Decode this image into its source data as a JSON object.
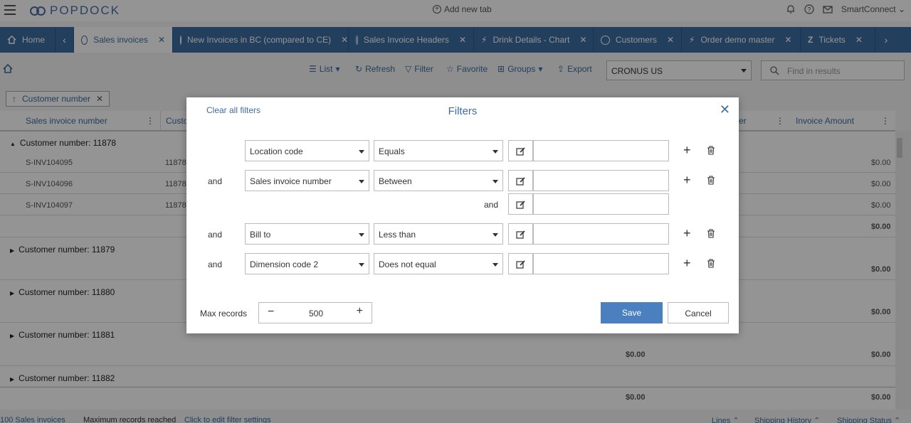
{
  "header": {
    "logo_text": "POPDOCK",
    "add_tab": "Add new tab",
    "user": "SmartConnect"
  },
  "tabs": [
    {
      "label": "Home"
    },
    {
      "label": "Sales invoices"
    },
    {
      "label": "New Invoices in BC (compared to CE)"
    },
    {
      "label": "Sales Invoice Headers"
    },
    {
      "label": "Drink Details - Chart"
    },
    {
      "label": "Customers"
    },
    {
      "label": "Order demo master"
    },
    {
      "label": "Tickets"
    }
  ],
  "toolbar": {
    "list": "List",
    "refresh": "Refresh",
    "filter": "Filter",
    "favorite": "Favorite",
    "groups": "Groups",
    "export": "Export",
    "company": "CRONUS US",
    "find_placeholder": "Find in results"
  },
  "group_chip": "Customer number",
  "grid": {
    "col_invoice": "Sales invoice number",
    "col_customer": "Custo",
    "col_partial": "er",
    "col_amount": "Invoice Amount",
    "groups": [
      {
        "label": "Customer number: 11878",
        "rows": [
          {
            "inv": "S-INV104095",
            "cust": "11878",
            "amount": "$0.00"
          },
          {
            "inv": "S-INV104096",
            "cust": "11878",
            "amount": "$0.00"
          },
          {
            "inv": "S-INV104097",
            "cust": "11878",
            "amount": "$0.00"
          }
        ],
        "subtotal": "$0.00"
      },
      {
        "label": "Customer number: 11879",
        "subtotal": "$0.00"
      },
      {
        "label": "Customer number: 11880",
        "subtotal": "$0.00"
      },
      {
        "label": "Customer number: 11881",
        "subtotal": "$0.00",
        "mid": "$0.00"
      },
      {
        "label": "Customer number: 11882"
      }
    ],
    "total_mid": "$0.00",
    "total": "$0.00"
  },
  "footer": {
    "count": "100 Sales invoices",
    "max_note": "Maximum records reached",
    "edit_link": "Click to edit filter settings",
    "lines": "Lines",
    "shipping_history": "Shipping History",
    "shipping_status": "Shipping Status"
  },
  "modal": {
    "clear": "Clear all filters",
    "title": "Filters",
    "rows": [
      {
        "conj": "",
        "field": "Location code",
        "op": "Equals"
      },
      {
        "conj": "and",
        "field": "Sales invoice number",
        "op": "Between",
        "and2": "and"
      },
      {
        "conj": "and",
        "field": "Bill to",
        "op": "Less than"
      },
      {
        "conj": "and",
        "field": "Dimension code 2",
        "op": "Does not equal"
      }
    ],
    "max_records_label": "Max records",
    "max_records_value": "500",
    "save": "Save",
    "cancel": "Cancel"
  },
  "colors": {
    "brand": "#3d6da3",
    "save": "#4a7fc0"
  }
}
